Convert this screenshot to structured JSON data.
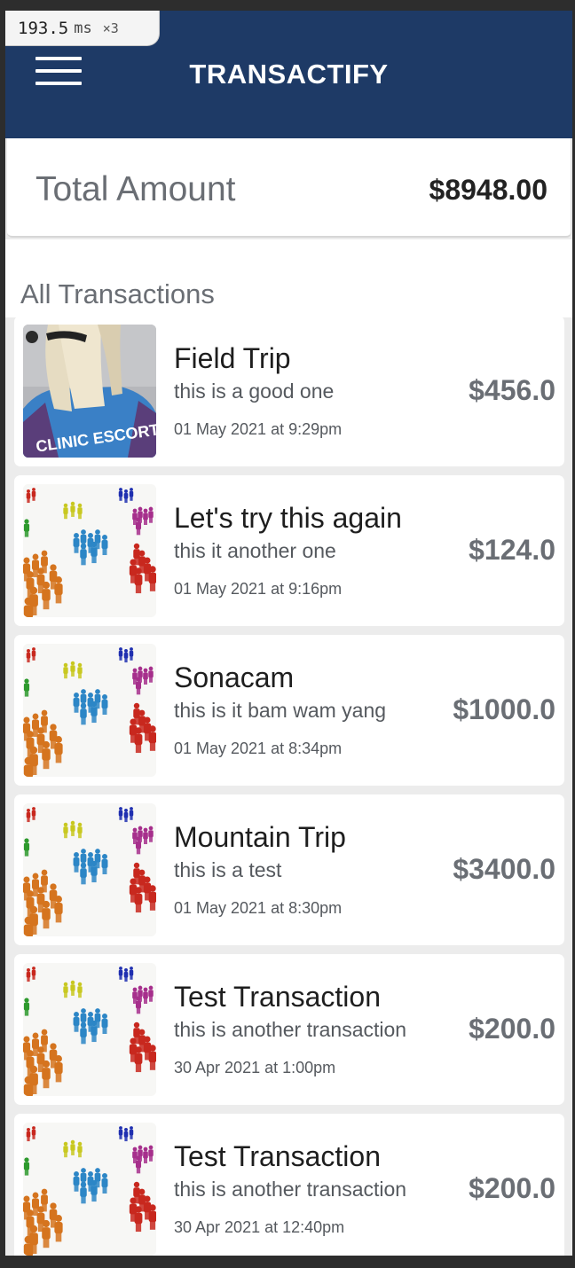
{
  "perf": {
    "value": "193.5",
    "unit": "ms",
    "multiplier": "×3"
  },
  "header": {
    "title": "TRANSACTIFY",
    "menu_icon": "hamburger-menu-icon"
  },
  "summary": {
    "label": "Total Amount",
    "value": "$8948.00"
  },
  "section": {
    "title": "All Transactions"
  },
  "transactions": [
    {
      "title": "Field Trip",
      "description": "this is a good one",
      "date": "01 May 2021 at 9:29pm",
      "amount": "$456.0",
      "thumbnail": "clinic-escort-photo",
      "vest_text": "CLINIC ESCORT"
    },
    {
      "title": "Let's try this again",
      "description": "this it another one",
      "date": "01 May 2021 at 9:16pm",
      "amount": "$124.0",
      "thumbnail": "colored-people-groups-image"
    },
    {
      "title": "Sonacam",
      "description": "this is it bam wam yang",
      "date": "01 May 2021 at 8:34pm",
      "amount": "$1000.0",
      "thumbnail": "colored-people-groups-image"
    },
    {
      "title": "Mountain Trip",
      "description": "this is a test",
      "date": "01 May 2021 at 8:30pm",
      "amount": "$3400.0",
      "thumbnail": "colored-people-groups-image"
    },
    {
      "title": "Test Transaction",
      "description": "this is another transaction",
      "date": "30 Apr 2021 at 1:00pm",
      "amount": "$200.0",
      "thumbnail": "colored-people-groups-image"
    },
    {
      "title": "Test Transaction",
      "description": "this is another transaction",
      "date": "30 Apr 2021 at 12:40pm",
      "amount": "$200.0",
      "thumbnail": "colored-people-groups-image"
    }
  ],
  "colors": {
    "header_bg": "#1e3a66",
    "page_bg": "#ececec",
    "card_bg": "#ffffff",
    "muted_text": "#6a6e74"
  }
}
